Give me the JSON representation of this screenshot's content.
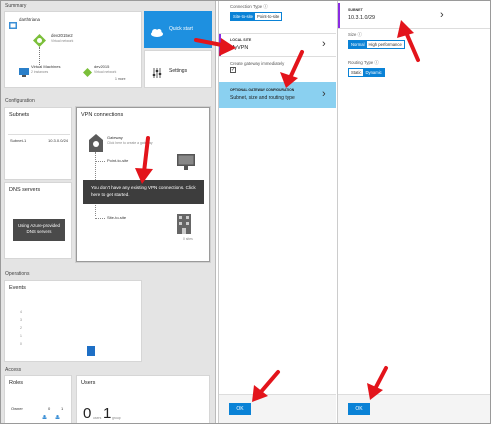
{
  "summary": {
    "section_title": "Summary",
    "vnet_name": "darthtriana",
    "vnet2_name": "dev2015e2",
    "vnet2_sub": "Virtual network",
    "vm_label": "Virtual Machines",
    "vm_sub": "2 instances",
    "dev2015_label": "dev2015",
    "dev2015_sub": "Virtual network",
    "more_link": "1 more",
    "quick_start": "Quick start",
    "settings": "Settings"
  },
  "configuration": {
    "section_title": "Configuration",
    "subnets_title": "Subnets",
    "subnet_name": "Subnet-1",
    "subnet_range": "10.3.0.0/24",
    "dns_title": "DNS servers",
    "dns_button": "Using Azure-provided DNS servers",
    "vpn_title": "VPN connections",
    "gateway_label": "Gateway",
    "gateway_sub": "Click here to create a gateway",
    "point_to_site": "Point-to-site",
    "site_to_site": "Site-to-site",
    "no_vpn_message": "You don't have any existing VPN connections. Click here to get started.",
    "s2s_count": "0 sites"
  },
  "operations": {
    "section_title": "Operations",
    "events_title": "Events",
    "y_ticks": [
      "4",
      "3",
      "2",
      "1",
      "0"
    ],
    "bar_value": 1
  },
  "access": {
    "section_title": "Access",
    "roles_title": "Roles",
    "owner_label": "Owner",
    "owner_val1": "0",
    "owner_val2": "1",
    "users_title": "Users",
    "users_count_a": "0",
    "users_sub_a": "users",
    "users_count_b": "1",
    "users_sub_b": "group"
  },
  "blade_vpn": {
    "connection_type_label": "Connection Type ⓘ",
    "option_s2s": "Site-to-site",
    "option_p2s": "Point-to-site",
    "local_site_label": "LOCAL SITE",
    "local_site_value": "MyVPN",
    "create_gateway_label": "Create gateway immediately",
    "optional_label": "OPTIONAL GATEWAY CONFIGURATION",
    "optional_value": "Subnet, size and routing type",
    "ok": "OK"
  },
  "blade_gateway": {
    "subnet_label": "SUBNET",
    "subnet_value": "10.3.1.0/29",
    "size_label": "Size ⓘ",
    "size_normal": "Normal",
    "size_high": "High performance",
    "routing_label": "Routing Type ⓘ",
    "routing_static": "Static",
    "routing_dynamic": "Dynamic",
    "ok": "OK"
  },
  "colors": {
    "accent": "#0a82d6",
    "arrow": "#e3141b",
    "selected_row": "#8ad0f0",
    "tile_blue": "#1e90e0",
    "purple_bar": "#8a2be2"
  }
}
